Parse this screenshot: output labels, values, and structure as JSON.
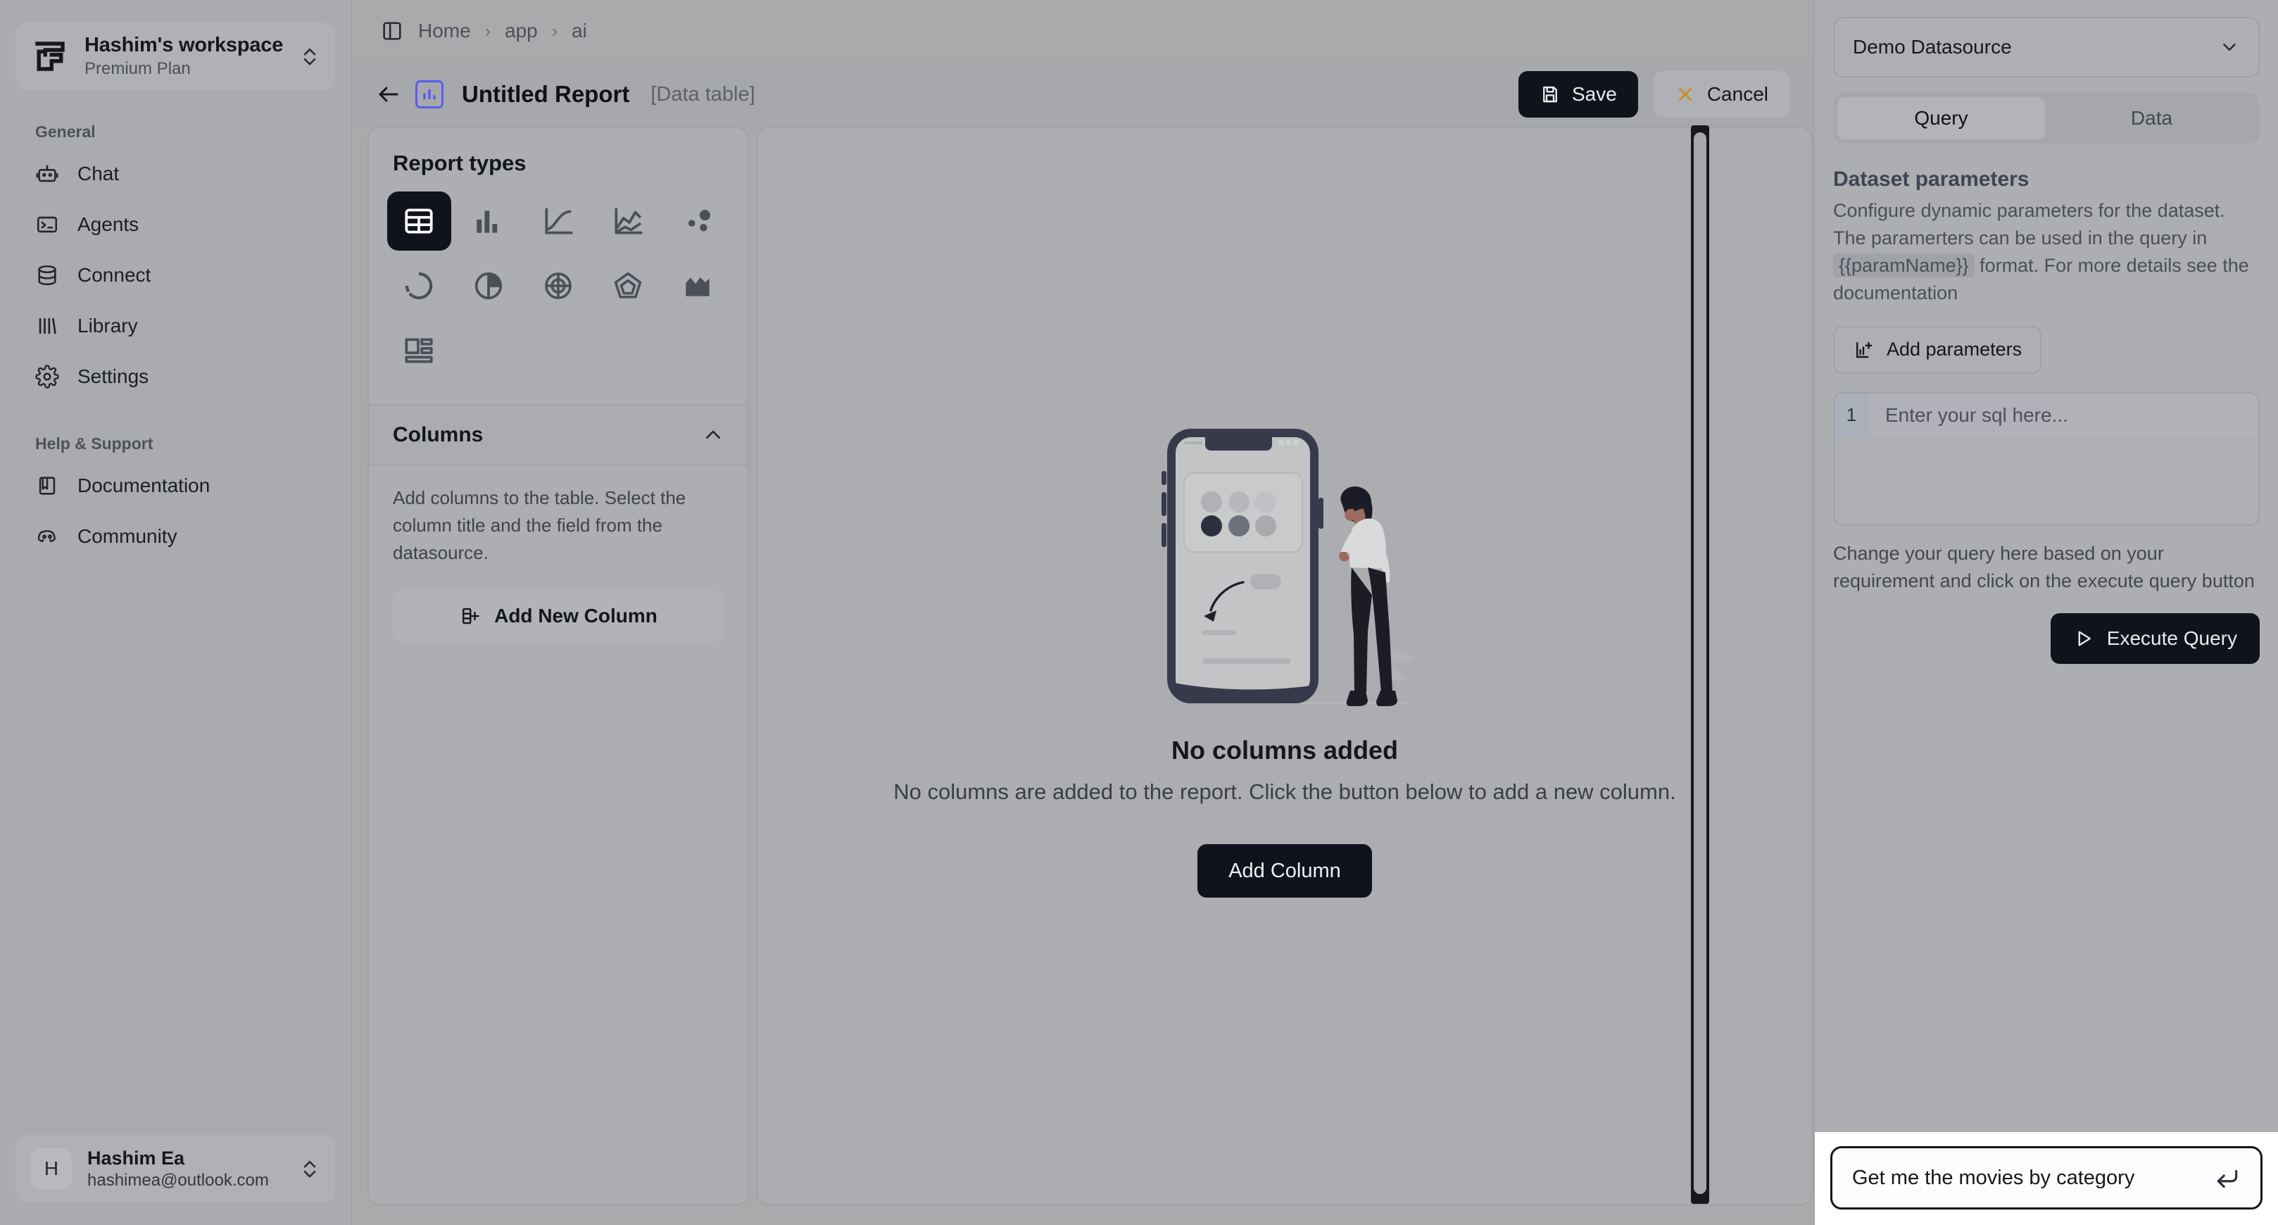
{
  "sidebar": {
    "workspace": {
      "name": "Hashim's workspace",
      "plan": "Premium Plan",
      "logo_icon": "workspace-logo-icon",
      "switch_icon": "chevron-up-down-icon"
    },
    "sections": [
      {
        "label": "General",
        "items": [
          {
            "label": "Chat",
            "icon": "robot-icon"
          },
          {
            "label": "Agents",
            "icon": "terminal-icon"
          },
          {
            "label": "Connect",
            "icon": "database-icon"
          },
          {
            "label": "Library",
            "icon": "bars-icon"
          },
          {
            "label": "Settings",
            "icon": "gear-icon"
          }
        ]
      },
      {
        "label": "Help & Support",
        "items": [
          {
            "label": "Documentation",
            "icon": "book-icon"
          },
          {
            "label": "Community",
            "icon": "discord-icon"
          }
        ]
      }
    ],
    "user": {
      "initial": "H",
      "name": "Hashim Ea",
      "email": "hashimea@outlook.com",
      "switch_icon": "chevron-up-down-icon"
    }
  },
  "breadcrumb": {
    "toggle_icon": "panel-toggle-icon",
    "items": [
      "Home",
      "app",
      "ai"
    ],
    "separator": "›"
  },
  "report_header": {
    "back_icon": "back-arrow-icon",
    "report_icon": "bar-chart-icon",
    "title": "Untitled Report",
    "subtitle": "[Data table]",
    "save_label": "Save",
    "save_icon": "save-icon",
    "cancel_label": "Cancel",
    "cancel_icon": "close-x-icon"
  },
  "left_pane": {
    "report_types_title": "Report types",
    "types": [
      {
        "name": "data-table",
        "icon": "table-icon",
        "active": true
      },
      {
        "name": "bar-chart",
        "icon": "bar-chart-icon",
        "active": false
      },
      {
        "name": "line-chart",
        "icon": "line-chart-icon",
        "active": false
      },
      {
        "name": "area-line-chart",
        "icon": "trend-chart-icon",
        "active": false
      },
      {
        "name": "bubble-chart",
        "icon": "bubble-chart-icon",
        "active": false
      },
      {
        "name": "progress-ring",
        "icon": "progress-ring-icon",
        "active": false
      },
      {
        "name": "pie-chart",
        "icon": "pie-chart-icon",
        "active": false
      },
      {
        "name": "radar-circle",
        "icon": "radial-chart-icon",
        "active": false
      },
      {
        "name": "polygon-chart",
        "icon": "pentagon-chart-icon",
        "active": false
      },
      {
        "name": "area-chart",
        "icon": "area-chart-icon",
        "active": false
      },
      {
        "name": "layout-card",
        "icon": "layout-card-icon",
        "active": false
      }
    ],
    "columns_section": {
      "title": "Columns",
      "collapse_icon": "chevron-up-icon",
      "description": "Add columns to the table. Select the column title and the field from the datasource.",
      "add_button_label": "Add New Column",
      "add_button_icon": "add-column-icon"
    }
  },
  "canvas": {
    "empty_title": "No columns added",
    "empty_description": "No columns are added to the report. Click the button below to add a new column.",
    "empty_button_label": "Add Column",
    "illustration": "person-with-phone-illustration"
  },
  "right_panel": {
    "datasource": {
      "value": "Demo Datasource",
      "chevron_icon": "chevron-down-icon"
    },
    "tabs": [
      {
        "label": "Query",
        "active": true
      },
      {
        "label": "Data",
        "active": false
      }
    ],
    "dataset_parameters": {
      "title": "Dataset parameters",
      "desc_part1": "Configure dynamic parameters for the dataset. The paramerters can be used in the query in",
      "code_token": "{{paramName}}",
      "desc_part2": "format. For more details see the documentation",
      "add_button_label": "Add parameters",
      "add_button_icon": "add-parameters-icon"
    },
    "sql_editor": {
      "line_number": "1",
      "placeholder": "Enter your sql here...",
      "hint": "Change your query here based on your requirement and click on the execute query button",
      "execute_label": "Execute Query",
      "execute_icon": "play-icon"
    },
    "prompt": {
      "text": "Get me the movies by category",
      "submit_icon": "enter-return-icon"
    }
  },
  "scrollbar": {
    "name": "vertical-scrollbar"
  },
  "colors": {
    "accent_dark": "#10131c",
    "report_icon_purple": "#5b5cf0",
    "cancel_x_gold": "#c4902b",
    "page_bg": "#a9aaac"
  }
}
